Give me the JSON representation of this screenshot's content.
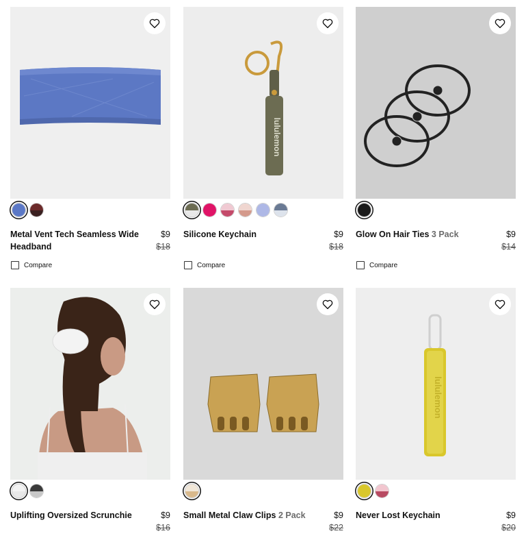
{
  "products": [
    {
      "name": "Metal Vent Tech Seamless Wide Headband",
      "pack": "",
      "price": "$9",
      "original_price": "$18",
      "image_bg": "#efefef",
      "compare_label": "Compare",
      "swatches": [
        {
          "top": "#5b78c6",
          "bottom": "#5b78c6",
          "selected": true
        },
        {
          "top": "#6c2a2a",
          "bottom": "#3a2020",
          "selected": false
        }
      ]
    },
    {
      "name": "Silicone Keychain",
      "pack": "",
      "price": "$9",
      "original_price": "$18",
      "image_bg": "#ededed",
      "compare_label": "Compare",
      "swatches": [
        {
          "top": "#6c6c52",
          "bottom": "#e9e9e9",
          "selected": true
        },
        {
          "top": "#e01467",
          "bottom": "#e01467",
          "selected": false
        },
        {
          "top": "#f0c9d2",
          "bottom": "#c44a6a",
          "selected": false
        },
        {
          "top": "#f0d6d0",
          "bottom": "#d49a8c",
          "selected": false
        },
        {
          "top": "#aeb8e6",
          "bottom": "#aeb8e6",
          "selected": false
        },
        {
          "top": "#6a7a94",
          "bottom": "#dde3ec",
          "selected": false
        }
      ]
    },
    {
      "name": "Glow On Hair Ties",
      "pack": "3 Pack",
      "price": "$9",
      "original_price": "$14",
      "image_bg": "#cfcfcf",
      "compare_label": "Compare",
      "swatches": [
        {
          "top": "#1a1a1a",
          "bottom": "#1a1a1a",
          "selected": true
        }
      ]
    },
    {
      "name": "Uplifting Oversized Scrunchie",
      "pack": "",
      "price": "$9",
      "original_price": "$16",
      "image_bg": "#eceeec",
      "compare_label": "",
      "swatches": [
        {
          "top": "#f3f3f3",
          "bottom": "#e8e8e8",
          "selected": true
        },
        {
          "top": "#3a3a3a",
          "bottom": "#c8c8c8",
          "selected": false
        }
      ]
    },
    {
      "name": "Small Metal Claw Clips",
      "pack": "2 Pack",
      "price": "$9",
      "original_price": "$22",
      "image_bg": "#d9d9d9",
      "compare_label": "",
      "swatches": [
        {
          "top": "#f1e7d8",
          "bottom": "#d9b98c",
          "selected": true
        }
      ]
    },
    {
      "name": "Never Lost Keychain",
      "pack": "",
      "price": "$9",
      "original_price": "$20",
      "image_bg": "#eeeeee",
      "compare_label": "",
      "swatches": [
        {
          "top": "#d9c72b",
          "bottom": "#d9c72b",
          "selected": true
        },
        {
          "top": "#f2c6cf",
          "bottom": "#b84a62",
          "selected": false
        }
      ]
    }
  ],
  "icons": {
    "wishlist": "heart-icon",
    "compare": "checkbox-icon"
  },
  "brand_text": "lululemon"
}
